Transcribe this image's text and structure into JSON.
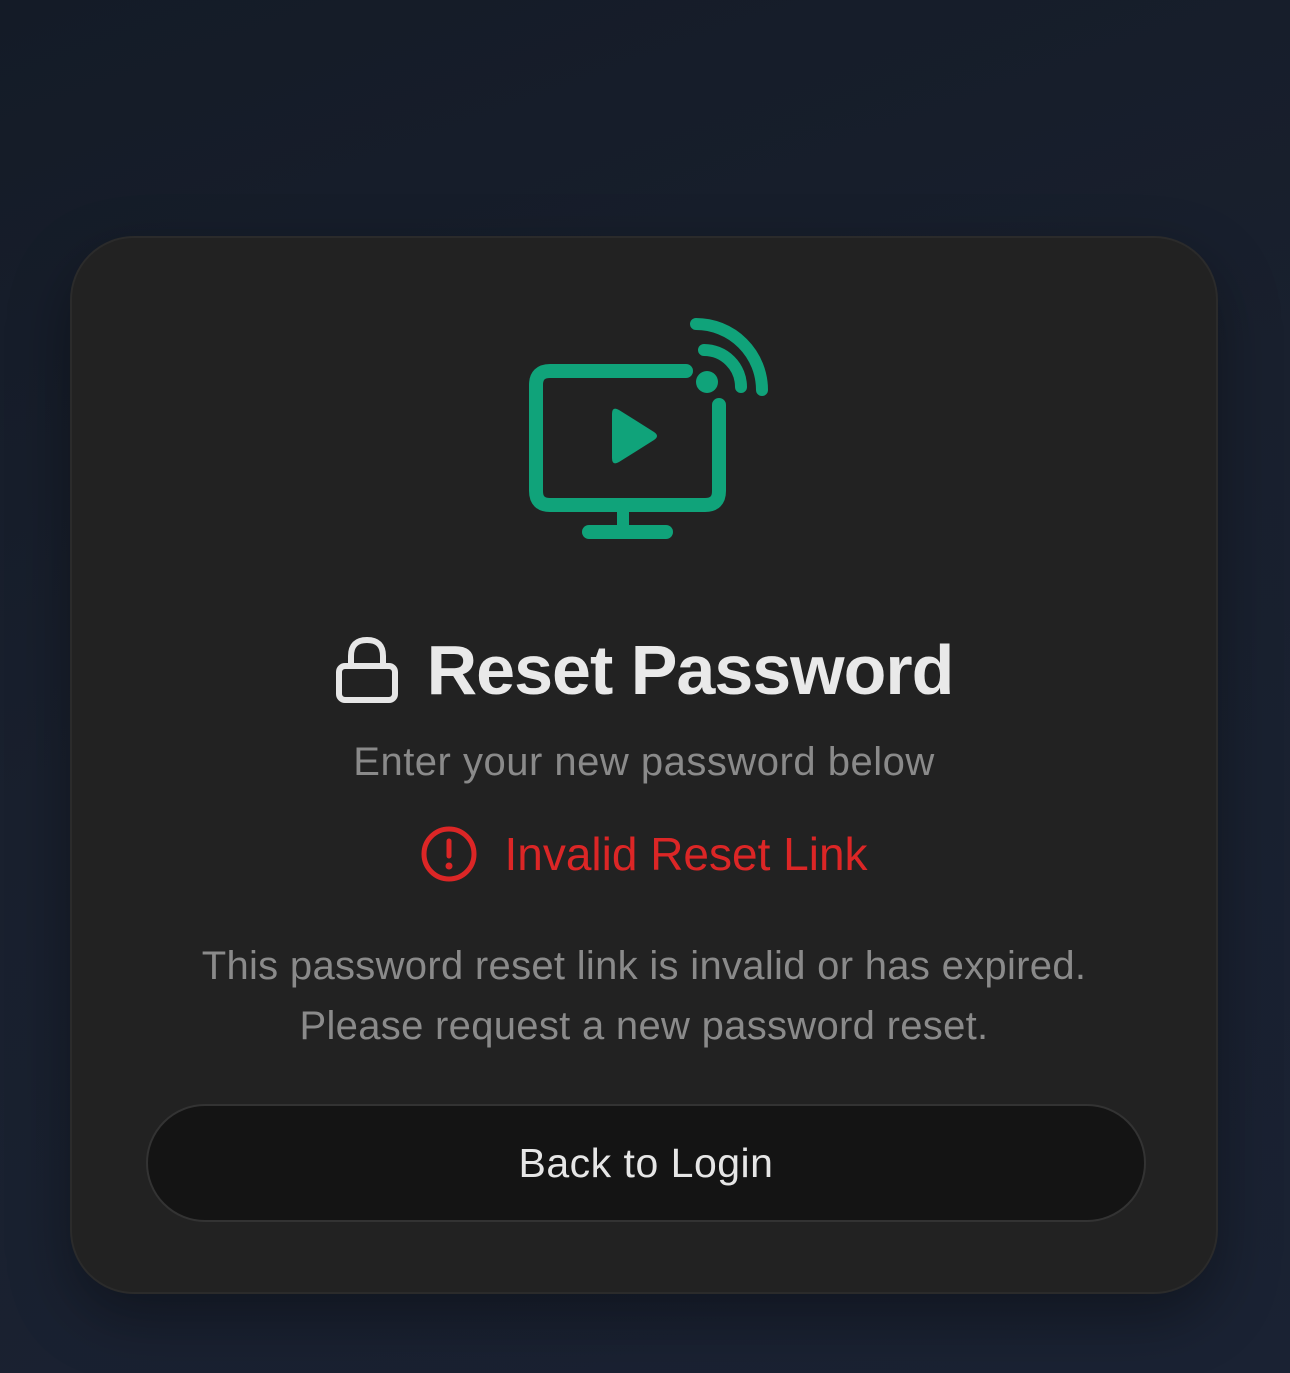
{
  "brand": {
    "logo_icon": "tv-cast-play-icon",
    "accent_color": "#10a37a"
  },
  "header": {
    "icon": "lock-icon",
    "title": "Reset Password",
    "subtitle": "Enter your new password below"
  },
  "error": {
    "icon": "alert-circle-icon",
    "title": "Invalid Reset Link",
    "color": "#dc2626",
    "message_line1": "This password reset link is invalid or has expired.",
    "message_line2": "Please request a new password reset."
  },
  "actions": {
    "back_label": "Back to Login"
  }
}
